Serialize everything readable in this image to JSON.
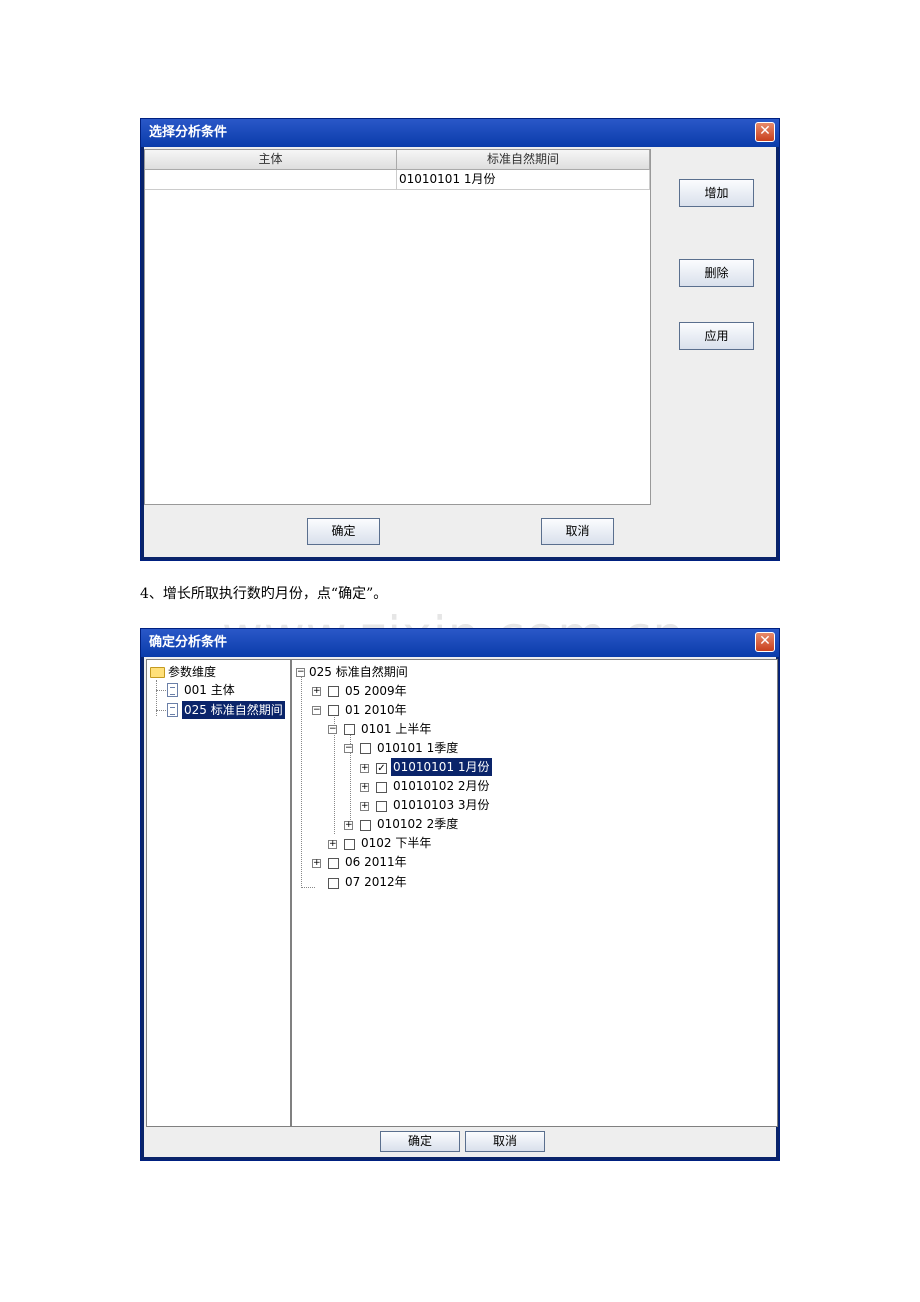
{
  "dialog1": {
    "title": "选择分析条件",
    "table": {
      "columns": [
        "主体",
        "标准自然期间"
      ],
      "rows": [
        [
          "",
          "01010101 1月份"
        ]
      ]
    },
    "buttons": {
      "add": "增加",
      "delete": "删除",
      "apply": "应用",
      "ok": "确定",
      "cancel": "取消"
    }
  },
  "caption": "4、增长所取执行数旳月份，点“确定”。",
  "watermark": "www.zixin.com.cn",
  "dialog2": {
    "title": "确定分析条件",
    "left_tree": {
      "root": "参数维度",
      "items": [
        "001 主体",
        "025 标准自然期间"
      ]
    },
    "right_tree": {
      "root": "025 标准自然期间",
      "nodes": [
        {
          "label": "05 2009年",
          "checked": false
        },
        {
          "label": "01 2010年",
          "checked": false
        },
        {
          "label": "0101 上半年",
          "checked": false
        },
        {
          "label": "010101 1季度",
          "checked": false
        },
        {
          "label": "01010101 1月份",
          "checked": true
        },
        {
          "label": "01010102 2月份",
          "checked": false
        },
        {
          "label": "01010103 3月份",
          "checked": false
        },
        {
          "label": "010102 2季度",
          "checked": false
        },
        {
          "label": "0102 下半年",
          "checked": false
        },
        {
          "label": "06 2011年",
          "checked": false
        },
        {
          "label": "07 2012年",
          "checked": false
        }
      ]
    },
    "buttons": {
      "ok": "确定",
      "cancel": "取消"
    }
  }
}
